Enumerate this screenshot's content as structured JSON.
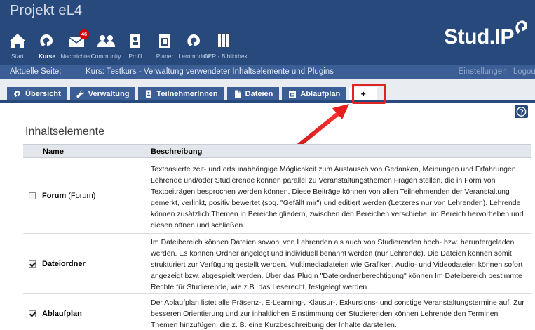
{
  "header": {
    "site_title": "Projekt eL4",
    "logo": "Stud.IP",
    "nav": [
      {
        "label": "Start",
        "icon": "home-icon"
      },
      {
        "label": "Kurse",
        "icon": "courses-icon",
        "active": true
      },
      {
        "label": "Nachrichten",
        "icon": "mail-icon",
        "badge": "46"
      },
      {
        "label": "Community",
        "icon": "community-icon"
      },
      {
        "label": "Profil",
        "icon": "profile-icon"
      },
      {
        "label": "Planer",
        "icon": "planner-icon"
      },
      {
        "label": "Lernmodule",
        "icon": "learning-modules-icon"
      },
      {
        "label": "OER - Bibliothek",
        "icon": "library-icon"
      }
    ]
  },
  "breadcrumb": {
    "label": "Aktuelle Seite:",
    "value": "Kurs: Testkurs - Verwaltung verwendeter Inhaltselemente und Plugins",
    "settings": "Einstellungen",
    "logout": "Logout"
  },
  "tabs": [
    {
      "label": "Übersicht",
      "icon": "courses-icon"
    },
    {
      "label": "Verwaltung",
      "icon": "wrench-icon"
    },
    {
      "label": "TeilnehmerInnen",
      "icon": "members-icon"
    },
    {
      "label": "Dateien",
      "icon": "file-icon"
    },
    {
      "label": "Ablaufplan",
      "icon": "schedule-icon"
    },
    {
      "label": "+",
      "icon": ""
    }
  ],
  "colors": {
    "header_bg": "#28497c",
    "tab_bg": "#3a5e95",
    "highlight_red": "#e02424"
  },
  "main": {
    "heading": "Inhaltselemente",
    "columns": {
      "name": "Name",
      "description": "Beschreibung"
    },
    "rows": [
      {
        "name": "Forum",
        "name_extra": "(Forum)",
        "checked": false,
        "description": "Textbasierte zeit- und ortsunabhängige Möglichkeit zum Austausch von Gedanken, Meinungen und Erfahrungen. Lehrende und/oder Studierende können parallel zu Veranstaltungsthemen Fragen stellen, die in Form von Textbeiträgen besprochen werden können. Diese Beiträge können von allen Teilnehmenden der Veranstaltung gemerkt, verlinkt, positiv bewertet (sog. \"Gefällt mir\") und editiert werden (Letzeres nur von Lehrenden). Lehrende können zusätzlich Themen in Bereiche gliedern, zwischen den Bereichen verschiebe, im Bereich hervorheben und diesen öffnen und schließen."
      },
      {
        "name": "Dateiordner",
        "name_extra": "",
        "checked": true,
        "description": "Im Dateibereich können Dateien sowohl von Lehrenden als auch von Studierenden hoch- bzw. heruntergeladen werden. Es können Ordner angelegt und individuell benannt werden (nur Lehrende). Die Dateien können somit strukturiert zur Verfügung gestellt werden. Multimediadateien wie Grafiken, Audio- und Videodateien können sofort angezeigt bzw. abgespielt werden. Über das PlugIn \"Dateiordnerberechtigung\" können Im Dateibereich bestimmte Rechte für Studierende, wie z.B. das Leserecht, festgelegt werden."
      },
      {
        "name": "Ablaufplan",
        "name_extra": "",
        "checked": true,
        "description": "Der Ablaufplan listet alle Präsenz-, E-Learning-, Klausur-, Exkursions- und sonstige Veranstaltungstermine auf. Zur besseren Orientierung und zur inhaltlichen Einstimmung der Studierenden können Lehrende den Terminen Themen hinzufügen, die z. B. eine Kurzbeschreibung der Inhalte darstellen."
      }
    ]
  }
}
